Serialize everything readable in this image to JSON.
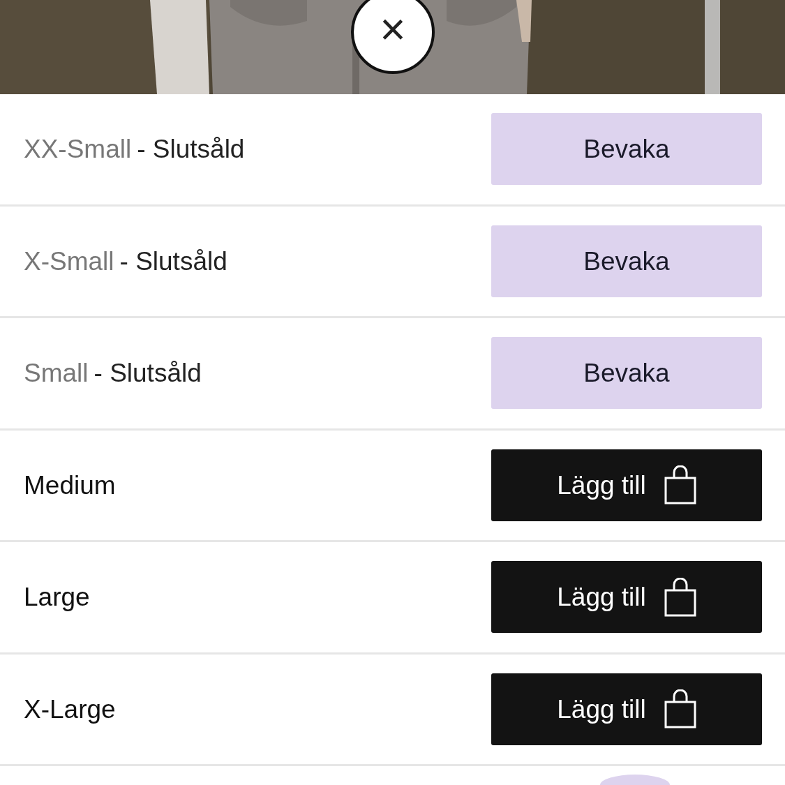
{
  "close_button": {
    "label": "×"
  },
  "sizes": [
    {
      "size": "XX-Small",
      "status": "- Slutsåld",
      "sold_out": true,
      "kind": "notify",
      "button": "Bevaka"
    },
    {
      "size": "X-Small",
      "status": "- Slutsåld",
      "sold_out": true,
      "kind": "notify",
      "button": "Bevaka"
    },
    {
      "size": "Small",
      "status": "- Slutsåld",
      "sold_out": true,
      "kind": "notify",
      "button": "Bevaka"
    },
    {
      "size": "Medium",
      "sold_out": false,
      "kind": "add",
      "button": "Lägg till"
    },
    {
      "size": "Large",
      "sold_out": false,
      "kind": "add",
      "button": "Lägg till"
    },
    {
      "size": "X-Large",
      "sold_out": false,
      "kind": "add",
      "button": "Lägg till"
    }
  ]
}
